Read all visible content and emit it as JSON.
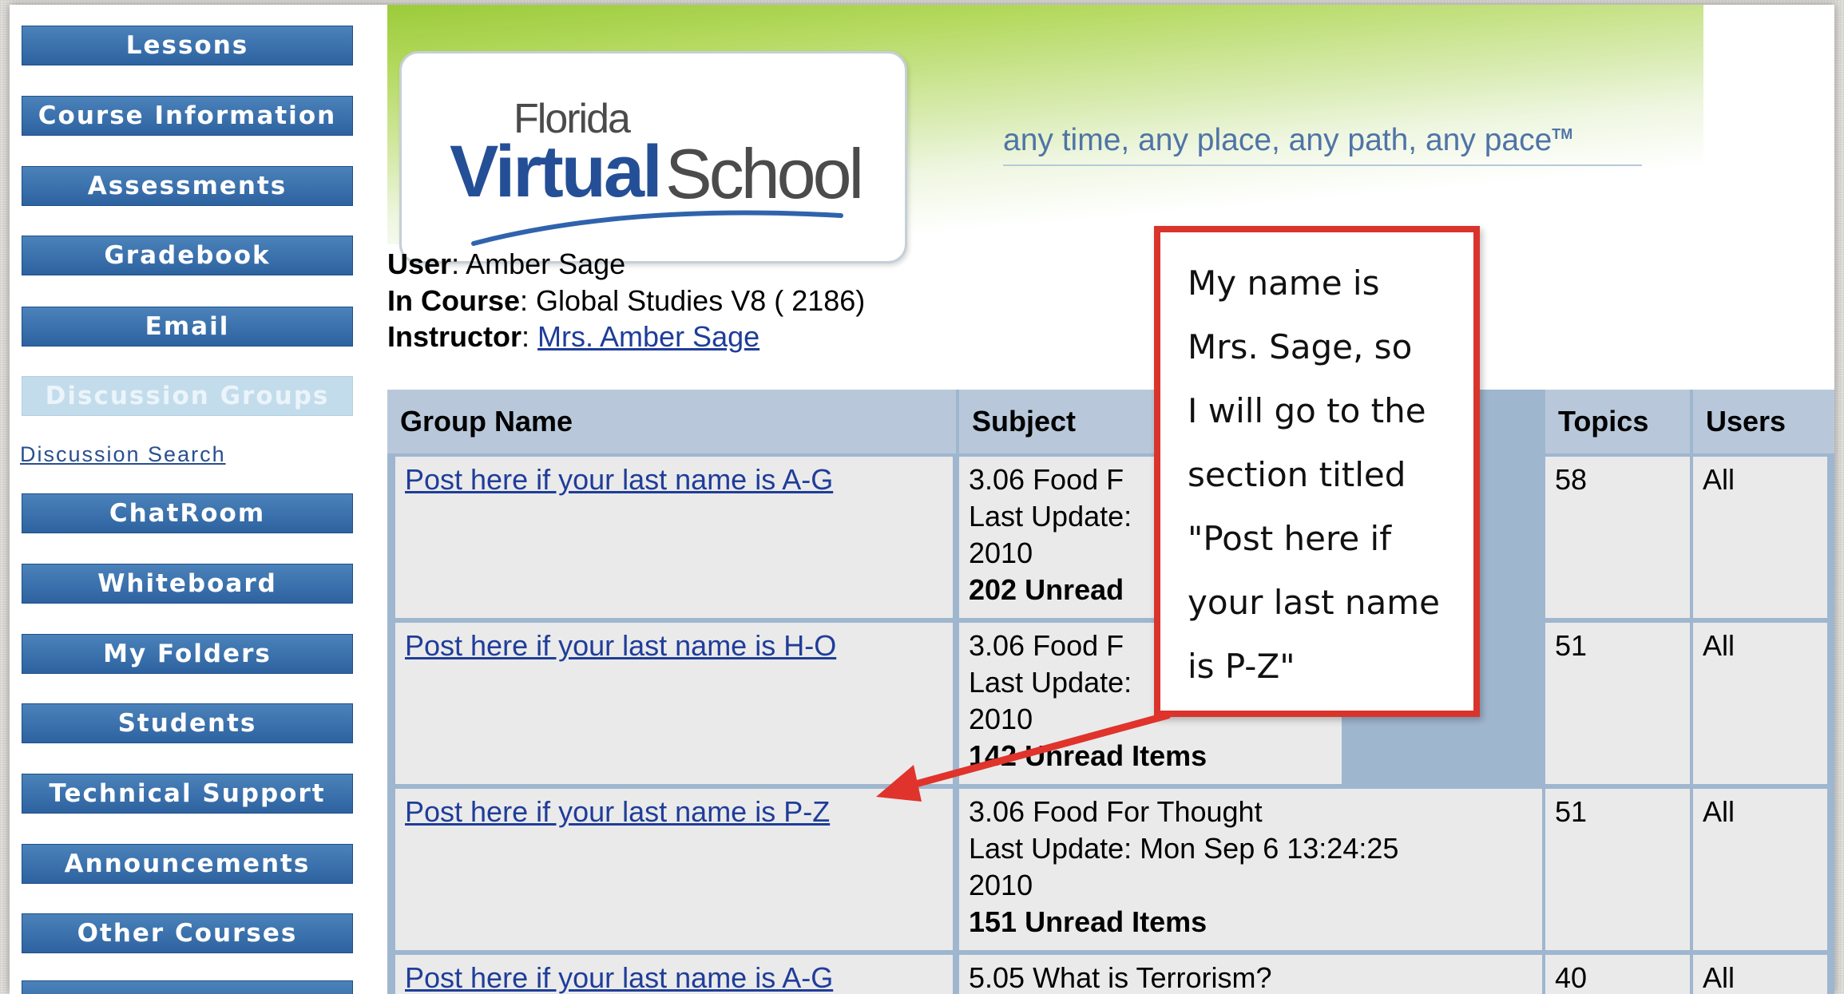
{
  "sidebar": {
    "items": [
      {
        "label": "Lessons"
      },
      {
        "label": "Course Information"
      },
      {
        "label": "Assessments"
      },
      {
        "label": "Gradebook"
      },
      {
        "label": "Email"
      },
      {
        "label": "Discussion Groups"
      },
      {
        "label": "ChatRoom"
      },
      {
        "label": "Whiteboard"
      },
      {
        "label": "My Folders"
      },
      {
        "label": "Students"
      },
      {
        "label": "Technical Support"
      },
      {
        "label": "Announcements"
      },
      {
        "label": "Other Courses"
      }
    ],
    "sub_link": "Discussion Search"
  },
  "banner": {
    "logo_florida": "Florida",
    "logo_virtual": "Virtual",
    "logo_school": "School",
    "tagline": "any time, any place, any path, any pace",
    "tagline_tm": "TM"
  },
  "info": {
    "user_label": "User",
    "user_value": "Amber Sage",
    "course_label": "In Course",
    "course_value": "Global Studies V8 ( 2186)",
    "instructor_label": "Instructor",
    "instructor_value": "Mrs. Amber Sage"
  },
  "table": {
    "headers": {
      "group": "Group Name",
      "subject": "Subject",
      "topics": "Topics",
      "users": "Users"
    },
    "rows": [
      {
        "group": "Post here if your last name is A-G",
        "subject_title": "3.06 Food F",
        "subject_update": "Last Update:",
        "subject_year": "2010",
        "subject_unread": "202 Unread",
        "topics": "58",
        "users": "All"
      },
      {
        "group": "Post here if your last name is H-O",
        "subject_title": "3.06 Food F",
        "subject_update": "Last Update:",
        "subject_year": "2010",
        "subject_unread": "142 Unread Items",
        "topics": "51",
        "users": "All"
      },
      {
        "group": "Post here if your last name is P-Z",
        "subject_title": "3.06 Food For Thought",
        "subject_update": "Last Update: Mon Sep 6 13:24:25",
        "subject_year": "2010",
        "subject_unread": "151 Unread Items",
        "topics": "51",
        "users": "All"
      },
      {
        "group": "Post here if your last name is A-G",
        "subject_title": "5.05 What is Terrorism?",
        "subject_update": "",
        "subject_year": "",
        "subject_unread": "",
        "topics": "40",
        "users": "All"
      }
    ]
  },
  "callout": {
    "lines": [
      "My name is",
      "Mrs. Sage, so",
      "I will go to the",
      "section titled",
      "\"Post here if",
      "your last name",
      "is P-Z\""
    ]
  },
  "colors": {
    "nav": "#2d62a0",
    "nav_active": "#c3dceb",
    "callout_border": "#d9342c",
    "table_border": "#9fb6cf",
    "link": "#1f3d99"
  }
}
